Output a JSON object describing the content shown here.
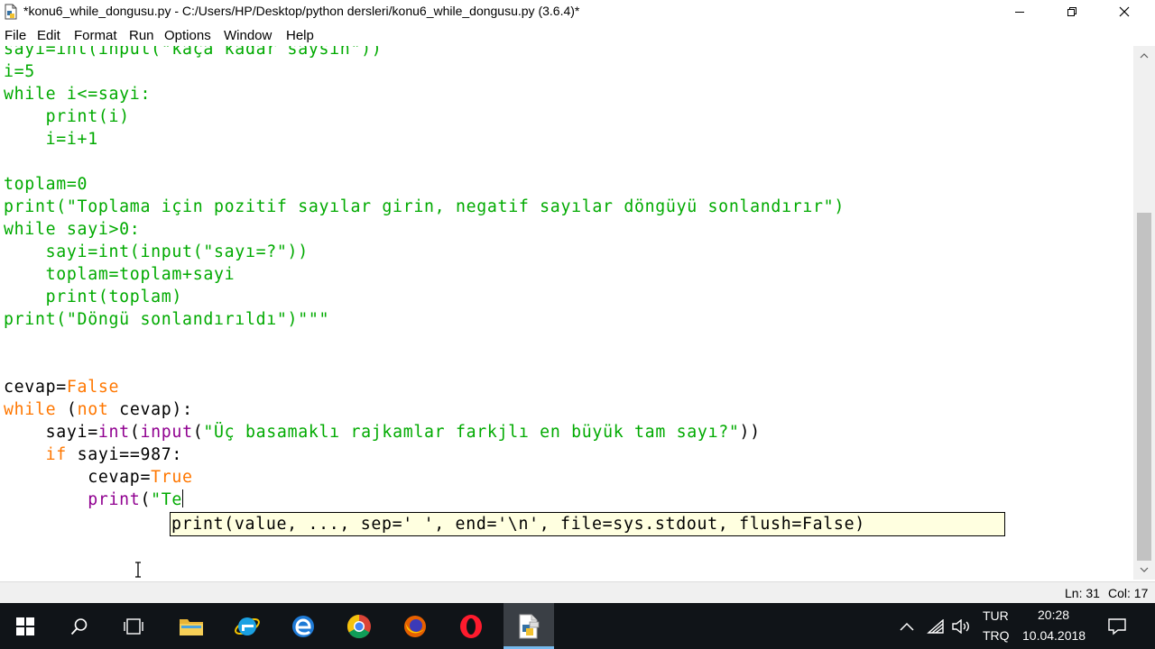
{
  "window": {
    "title": "*konu6_while_dongusu.py - C:/Users/HP/Desktop/python dersleri/konu6_while_dongusu.py (3.6.4)*"
  },
  "menu": {
    "items": [
      {
        "label": "File"
      },
      {
        "label": "Edit"
      },
      {
        "label": "Format"
      },
      {
        "label": "Run"
      },
      {
        "label": "Options"
      },
      {
        "label": "Window"
      },
      {
        "label": "Help"
      }
    ]
  },
  "editor": {
    "lines": [
      "sayi=int(input(\"kaça kadar saysın\"))",
      "i=5",
      "while i<=sayi:",
      "    print(i)",
      "    i=i+1",
      "",
      "toplam=0",
      "print(\"Toplama için pozitif sayılar girin, negatif sayılar döngüyü sonlandırır\")",
      "while sayi>0:",
      "    sayi=int(input(\"sayı=?\"))",
      "    toplam=toplam+sayi",
      "    print(toplam)",
      "print(\"Döngü sonlandırıldı\")\"\"\"",
      "",
      "",
      "cevap=",
      "False",
      "while",
      " (",
      "not",
      " cevap):",
      "    sayi=",
      "int",
      "(",
      "input",
      "(",
      "\"Üç basamaklı rajkamlar farkjlı en büyük tam sayı?\"",
      "))",
      "    ",
      "if",
      " sayi==987:",
      "        cevap=",
      "True",
      "        ",
      "print",
      "(",
      "\"Te"
    ],
    "calltip": "print(value, ..., sep=' ', end='\\n', file=sys.stdout, flush=False)"
  },
  "status": {
    "line": "Ln: 31",
    "col": "Col: 17"
  },
  "taskbar": {
    "language_top": "TUR",
    "language_bottom": "TRQ",
    "time": "20:28",
    "date": "10.04.2018"
  },
  "colors": {
    "string": "#00aa00",
    "keyword": "#ff7700",
    "builtin": "#900090",
    "calltip_bg": "#ffffe0",
    "taskbar_bg": "#101418"
  }
}
